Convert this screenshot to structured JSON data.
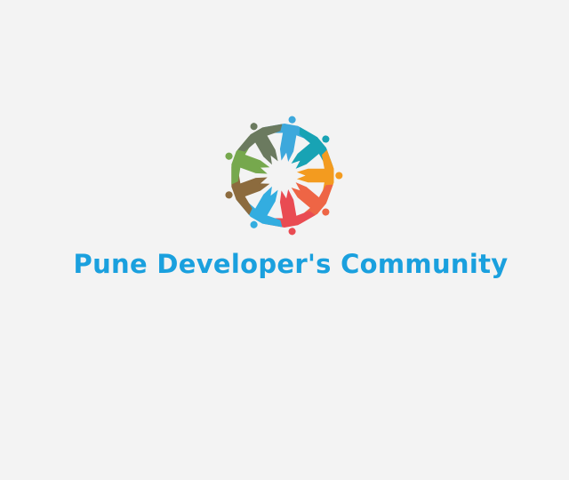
{
  "brand": {
    "name": "Pune Developer's Community",
    "text_color": "#1aa0de"
  },
  "logo": {
    "icon": "people-circle-icon",
    "colors": [
      "#3da8dc",
      "#18a3b4",
      "#f39b1f",
      "#ee6545",
      "#e94b52",
      "#33ade0",
      "#8c6b3e",
      "#76a84d",
      "#6b7a5f"
    ]
  }
}
